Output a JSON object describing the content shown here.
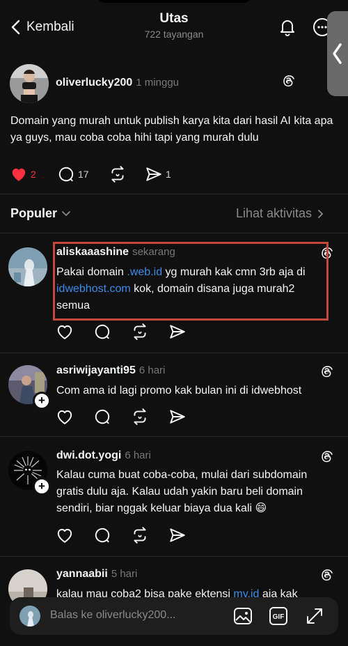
{
  "header": {
    "back_label": "Kembali",
    "title": "Utas",
    "views": "722 tayangan"
  },
  "main_post": {
    "username": "oliverlucky200",
    "time": "1 minggu",
    "text": "Domain yang murah untuk publish karya kita dari hasil AI kita apa ya guys, mau coba coba hihi tapi yang murah dulu",
    "likes": "2",
    "replies": "17",
    "shares": "1"
  },
  "sort": {
    "label": "Populer",
    "activity_label": "Lihat aktivitas"
  },
  "comments": [
    {
      "username": "aliskaaashine",
      "time": "sekarang",
      "text_1": "Pakai domain ",
      "link_1": ".web.id",
      "text_2": " yg murah kak cmn 3rb aja di ",
      "link_2": "idwebhost.com",
      "text_3": " kok, domain disana juga murah2 semua"
    },
    {
      "username": "asriwijayanti95",
      "time": "6 hari",
      "text": "Com ama id lagi promo kak bulan ini di idwebhost"
    },
    {
      "username": "dwi.dot.yogi",
      "time": "6 hari",
      "text": "Kalau cuma buat coba-coba, mulai dari subdomain gratis dulu aja. Kalau udah yakin baru beli domain sendiri, biar nggak keluar biaya dua kali 😄"
    },
    {
      "username": "yannaabii",
      "time": "5 hari",
      "text_1": "kalau mau coba2 bisa pake ektensi ",
      "link_1": "my.id",
      "text_2": " aja kak"
    }
  ],
  "reply_bar": {
    "placeholder": "Balas ke oliverlucky200..."
  },
  "colors": {
    "background": "#101010",
    "heart": "#ff3040",
    "link": "#3b8be8",
    "highlight_box": "#c3483b"
  },
  "icons": {
    "back": "chevron-left-icon",
    "notifications": "bell-icon",
    "more": "more-icon",
    "threads": "threads-logo-icon",
    "like": "heart-icon",
    "reply": "comment-icon",
    "repost": "repost-icon",
    "share": "send-icon",
    "image": "image-icon",
    "gif": "gif-icon",
    "expand": "expand-icon"
  }
}
